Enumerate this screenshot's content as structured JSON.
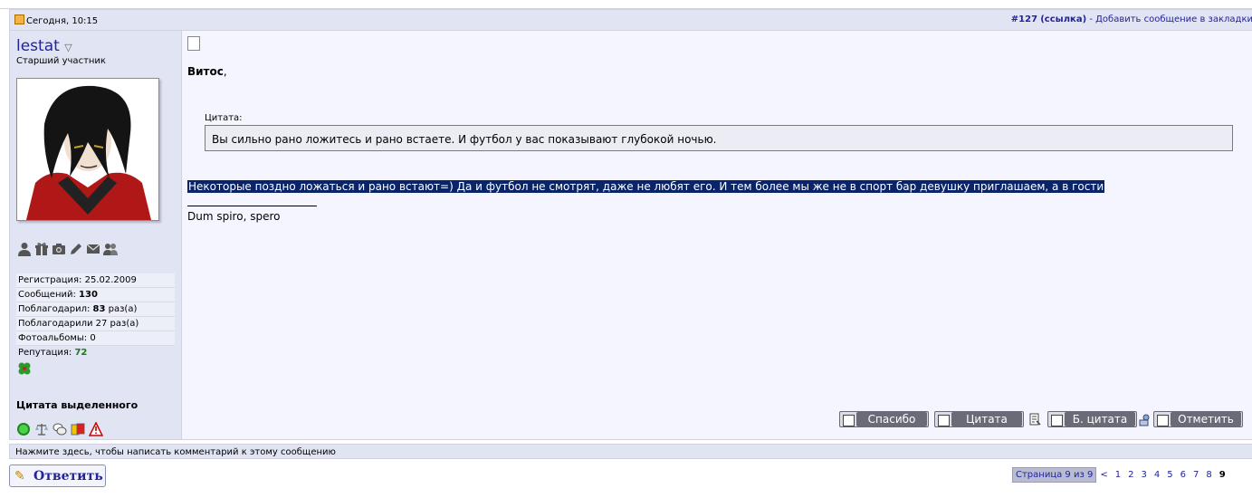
{
  "post": {
    "date": "Сегодня, 10:15",
    "number": "#127",
    "link_label": "(ссылка)",
    "bookmark_text": " - Добавить сообщение в закладки"
  },
  "user": {
    "name": "lestat",
    "title": "Старший участник",
    "stats": {
      "registration_label": "Регистрация: ",
      "registration_value": "25.02.2009",
      "messages_label": "Сообщений: ",
      "messages_value": "130",
      "thanked_label": "Поблагодарил: ",
      "thanked_value": "83",
      "thanked_suffix": " раз(а)",
      "was_thanked_label": "Поблагодарили 27 раз(а)",
      "albums_label": "Фотоальбомы: 0",
      "reputation_label": "Репутация: ",
      "reputation_value": "72"
    },
    "quote_selected": "Цитата выделенного"
  },
  "message": {
    "salutation": "Витос",
    "salutation_comma": ",",
    "quote_label": "Цитата:",
    "quote_text": "Вы сильно рано ложитесь и рано встаете. И футбол у вас показывают глубокой ночью.",
    "body_selected": "Некоторые поздно ложаться и рано встают=) Да и футбол не смотрят, даже не любят его. И тем более мы же не в спорт бар девушку приглашаем, а в гости",
    "signature": "Dum spiro, spero"
  },
  "buttons": {
    "thanks": "Спасибо",
    "quote": "Цитата",
    "fast_quote": "Б. цитата",
    "report": "Отметить"
  },
  "comment_bar": "Нажмите здесь, чтобы написать комментарий к этому сообщению",
  "reply_button": "Ответить",
  "pager": {
    "label": "Страница 9 из 9",
    "prev": "<",
    "pages": [
      "1",
      "2",
      "3",
      "4",
      "5",
      "6",
      "7",
      "8",
      "9"
    ],
    "current": "9"
  }
}
